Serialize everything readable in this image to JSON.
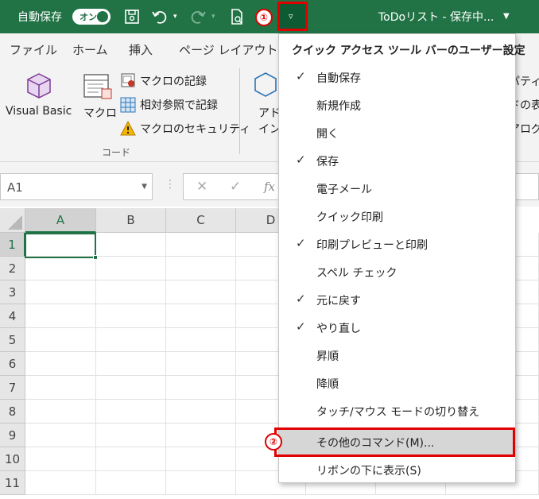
{
  "titlebar": {
    "autosave_label": "自動保存",
    "autosave_toggle": "オン",
    "document_title": "ToDoリスト - 保存中...",
    "badge1": "①"
  },
  "tabs": [
    "ファイル",
    "ホーム",
    "挿入",
    "ページ レイアウト"
  ],
  "ribbon": {
    "visual_basic": "Visual Basic",
    "macro": "マクロ",
    "record_macro": "マクロの記録",
    "relative_ref": "相対参照で記録",
    "macro_security": "マクロのセキュリティ",
    "addin_line1": "アド",
    "addin_line2": "イン",
    "group_code": "コード",
    "partial1": "パティ",
    "partial2": "ドの表",
    "partial3": "アログの"
  },
  "formula_bar": {
    "name_box": "A1",
    "fx": "fx"
  },
  "grid": {
    "columns": [
      "A",
      "B",
      "C",
      "D"
    ],
    "rows": [
      "1",
      "2",
      "3",
      "4",
      "5",
      "6",
      "7",
      "8",
      "9",
      "10",
      "11"
    ]
  },
  "menu": {
    "title": "クイック アクセス ツール バーのユーザー設定",
    "items": [
      {
        "label": "自動保存",
        "check": "✓"
      },
      {
        "label": "新規作成",
        "check": ""
      },
      {
        "label": "開く",
        "check": ""
      },
      {
        "label": "保存",
        "check": "✓"
      },
      {
        "label": "電子メール",
        "check": ""
      },
      {
        "label": "クイック印刷",
        "check": ""
      },
      {
        "label": "印刷プレビューと印刷",
        "check": "✓"
      },
      {
        "label": "スペル チェック",
        "check": ""
      },
      {
        "label": "元に戻す",
        "check": "✓"
      },
      {
        "label": "やり直し",
        "check": "✓"
      },
      {
        "label": "昇順",
        "check": ""
      },
      {
        "label": "降順",
        "check": ""
      },
      {
        "label": "タッチ/マウス モードの切り替え",
        "check": ""
      },
      {
        "label": "その他のコマンド(M)...",
        "check": ""
      },
      {
        "label": "リボンの下に表示(S)",
        "check": ""
      }
    ],
    "badge2": "②"
  }
}
